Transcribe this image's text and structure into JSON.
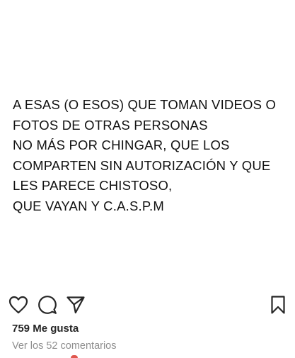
{
  "post": {
    "caption_lines": [
      "A ESAS (O ESOS) QUE TOMAN VIDEOS O",
      "FOTOS DE OTRAS PERSONAS",
      "NO MÁS POR CHINGAR, QUE LOS",
      "COMPARTEN SIN AUTORIZACIÓN Y QUE",
      "LES PARECE CHISTOSO,",
      "QUE VAYAN Y C.A.S.P.M"
    ],
    "text_color": "#111111",
    "background_color": "#ffffff"
  },
  "actions": {
    "icons": [
      "heart-icon",
      "comment-icon",
      "share-icon",
      "bookmark-icon"
    ],
    "icon_color": "#262626"
  },
  "likes": {
    "label": "759 Me gusta"
  },
  "comments": {
    "label": "Ver los 52 comentarios",
    "color": "#8e8e8e"
  }
}
